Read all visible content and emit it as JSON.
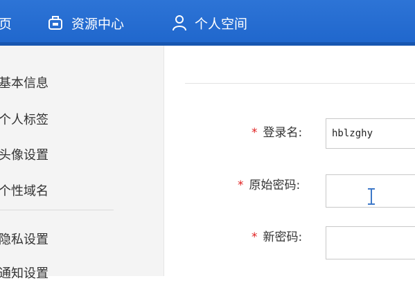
{
  "nav": {
    "home_label": "页",
    "resource_label": "资源中心",
    "space_label": "个人空间",
    "icons": [
      "home-icon",
      "resource-icon",
      "user-icon"
    ]
  },
  "sidebar": {
    "items": [
      {
        "label": "基本信息"
      },
      {
        "label": "个人标签"
      },
      {
        "label": "头像设置"
      },
      {
        "label": "个性域名"
      },
      {
        "label": "隐私设置"
      },
      {
        "label": "通知设置"
      }
    ]
  },
  "form": {
    "required_mark": "*",
    "login_label": "登录名:",
    "login_value": "hblzghy",
    "old_password_label": "原始密码:",
    "old_password_value": "",
    "new_password_label": "新密码:",
    "new_password_value": ""
  },
  "colors": {
    "topbar": "#1f66cc",
    "required": "#e02020",
    "sidebar_bg": "#f4f4f4"
  }
}
